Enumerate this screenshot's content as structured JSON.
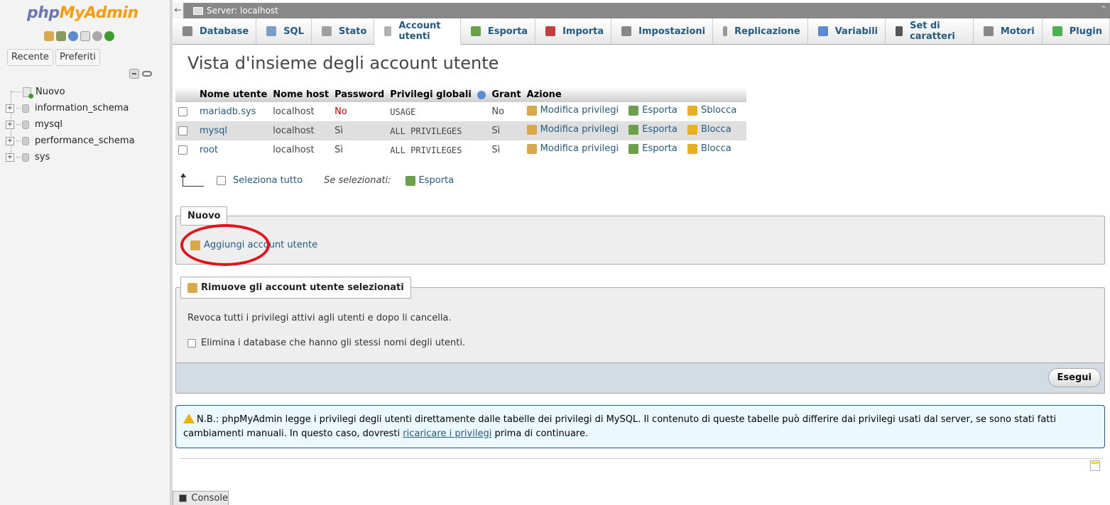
{
  "app": {
    "logo_php": "php",
    "logo_myadmin": "MyAdmin"
  },
  "nav": {
    "tabs": [
      "Recente",
      "Preferiti"
    ],
    "tree": [
      {
        "label": "Nuovo",
        "type": "new"
      },
      {
        "label": "information_schema",
        "type": "db"
      },
      {
        "label": "mysql",
        "type": "db"
      },
      {
        "label": "performance_schema",
        "type": "db"
      },
      {
        "label": "sys",
        "type": "db"
      }
    ]
  },
  "serverbar": {
    "title": "Server: localhost"
  },
  "tabs": [
    {
      "label": "Database",
      "icon": "database-icon",
      "color": "#888888"
    },
    {
      "label": "SQL",
      "icon": "sql-icon",
      "color": "#7a9cc6"
    },
    {
      "label": "Stato",
      "icon": "status-icon",
      "color": "#a0a0a0"
    },
    {
      "label": "Account utenti",
      "icon": "users-icon",
      "color": "#b0b0b0"
    },
    {
      "label": "Esporta",
      "icon": "export-icon",
      "color": "#6aa04a"
    },
    {
      "label": "Importa",
      "icon": "import-icon",
      "color": "#c04040"
    },
    {
      "label": "Impostazioni",
      "icon": "wrench-icon",
      "color": "#888888"
    },
    {
      "label": "Replicazione",
      "icon": "replication-icon",
      "color": "#999999"
    },
    {
      "label": "Variabili",
      "icon": "variables-icon",
      "color": "#5a8ad0"
    },
    {
      "label": "Set di caratteri",
      "icon": "charset-icon",
      "color": "#555555"
    },
    {
      "label": "Motori",
      "icon": "engines-icon",
      "color": "#888888"
    },
    {
      "label": "Plugin",
      "icon": "plugin-icon",
      "color": "#4caf50"
    }
  ],
  "active_tab": "Account utenti",
  "main": {
    "title": "Vista d'insieme degli account utente",
    "table": {
      "headers": [
        "Nome utente",
        "Nome host",
        "Password",
        "Privilegi globali",
        "Grant",
        "Azione"
      ],
      "rows": [
        {
          "user": "mariadb.sys",
          "host": "localhost",
          "password": "No",
          "privs": "USAGE",
          "grant": "No",
          "edit": "Modifica privilegi",
          "export": "Esporta",
          "lock": "Sblocca"
        },
        {
          "user": "mysql",
          "host": "localhost",
          "password": "Sì",
          "privs": "ALL PRIVILEGES",
          "grant": "Sì",
          "edit": "Modifica privilegi",
          "export": "Esporta",
          "lock": "Blocca"
        },
        {
          "user": "root",
          "host": "localhost",
          "password": "Sì",
          "privs": "ALL PRIVILEGES",
          "grant": "Sì",
          "edit": "Modifica privilegi",
          "export": "Esporta",
          "lock": "Blocca"
        }
      ]
    },
    "select_all": "Seleziona tutto",
    "with_selected": "Se selezionati:",
    "bulk_export": "Esporta",
    "new_legend": "Nuovo",
    "add_user": "Aggiungi account utente",
    "remove_legend": "Rimuove gli account utente selezionati",
    "remove_text": "Revoca tutti i privilegi attivi agli utenti e dopo li cancella.",
    "drop_db_label": "Elimina i database che hanno gli stessi nomi degli utenti.",
    "go_button": "Esegui",
    "notice_before": "N.B.: phpMyAdmin legge i privilegi degli utenti direttamente dalle tabelle dei privilegi di MySQL. Il contenuto di queste tabelle può differire dai privilegi usati dal server, se sono stati fatti cambiamenti manuali. In questo caso, dovresti ",
    "notice_link": "ricaricare i privilegi",
    "notice_after": " prima di continuare."
  },
  "console": {
    "label": "Console"
  }
}
